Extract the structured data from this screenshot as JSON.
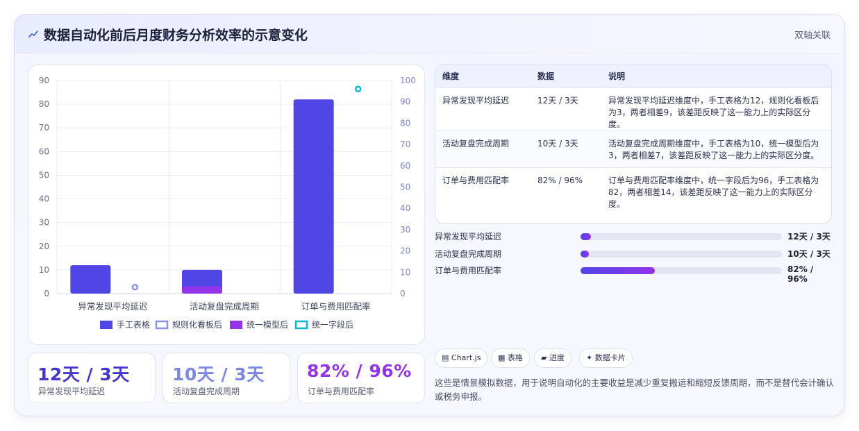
{
  "header": {
    "title": "数据自动化前后月度财务分析效率的示意变化",
    "badge": "双轴关联"
  },
  "chart_data": {
    "type": "bar",
    "categories": [
      "异常发现平均延迟",
      "活动复盘完成周期",
      "订单与费用匹配率"
    ],
    "y_left": {
      "ticks": [
        0,
        10,
        20,
        30,
        40,
        50,
        60,
        70,
        80,
        90
      ],
      "range": [
        0,
        90
      ]
    },
    "y_right": {
      "ticks": [
        0,
        10,
        20,
        30,
        40,
        50,
        60,
        70,
        80,
        90,
        100
      ],
      "range": [
        0,
        100
      ]
    },
    "grid": true,
    "legend_position": "bottom",
    "series": [
      {
        "name": "手工表格",
        "type": "bar",
        "axis": "left",
        "color": "#4f46e5",
        "values": [
          12,
          10,
          82
        ]
      },
      {
        "name": "规则化看板后",
        "type": "point",
        "axis": "right",
        "color": "#8b93e8",
        "values": [
          3,
          null,
          null
        ]
      },
      {
        "name": "统一模型后",
        "type": "bar",
        "axis": "left",
        "color": "#9333ea",
        "values": [
          null,
          3,
          null
        ]
      },
      {
        "name": "统一字段后",
        "type": "point",
        "axis": "right",
        "color": "#06b6d4",
        "values": [
          null,
          null,
          96
        ]
      }
    ]
  },
  "kpis": [
    {
      "value": "12天 / 3天",
      "label": "异常发现平均延迟",
      "color": "#4338ca"
    },
    {
      "value": "10天 / 3天",
      "label": "活动复盘完成周期",
      "color": "#7c87e6"
    },
    {
      "value": "82% / 96%",
      "label": "订单与费用匹配率",
      "color": "#9333ea"
    }
  ],
  "table": {
    "headers": [
      "维度",
      "数据",
      "说明"
    ],
    "rows": [
      [
        "异常发现平均延迟",
        "12天 / 3天",
        "异常发现平均延迟维度中，手工表格为12，规则化看板后为3，两者相差9，该差距反映了这一能力上的实际区分度。"
      ],
      [
        "活动复盘完成周期",
        "10天 / 3天",
        "活动复盘完成周期维度中，手工表格为10，统一模型后为3，两者相差7，该差距反映了这一能力上的实际区分度。"
      ],
      [
        "订单与费用匹配率",
        "82% / 96%",
        "订单与费用匹配率维度中，统一字段后为96，手工表格为82，两者相差14，该差距反映了这一能力上的实际区分度。"
      ]
    ]
  },
  "progress": [
    {
      "label": "异常发现平均延迟",
      "value": "12天 / 3天",
      "fill": 0.05
    },
    {
      "label": "活动复盘完成周期",
      "value": "10天 / 3天",
      "fill": 0.04
    },
    {
      "label": "订单与费用匹配率",
      "value": "82% / 96%",
      "fill": 0.37
    }
  ],
  "chips": [
    {
      "label": "Chart.js",
      "icon": "chart-icon"
    },
    {
      "label": "表格",
      "icon": "table-icon"
    },
    {
      "label": "进度",
      "icon": "progress-icon"
    },
    {
      "label": "数据卡片",
      "icon": "sparkle-icon"
    }
  ],
  "note": "这些是情景模拟数据，用于说明自动化的主要收益是减少重复搬运和缩短反馈周期，而不是替代会计确认或税务申报。"
}
